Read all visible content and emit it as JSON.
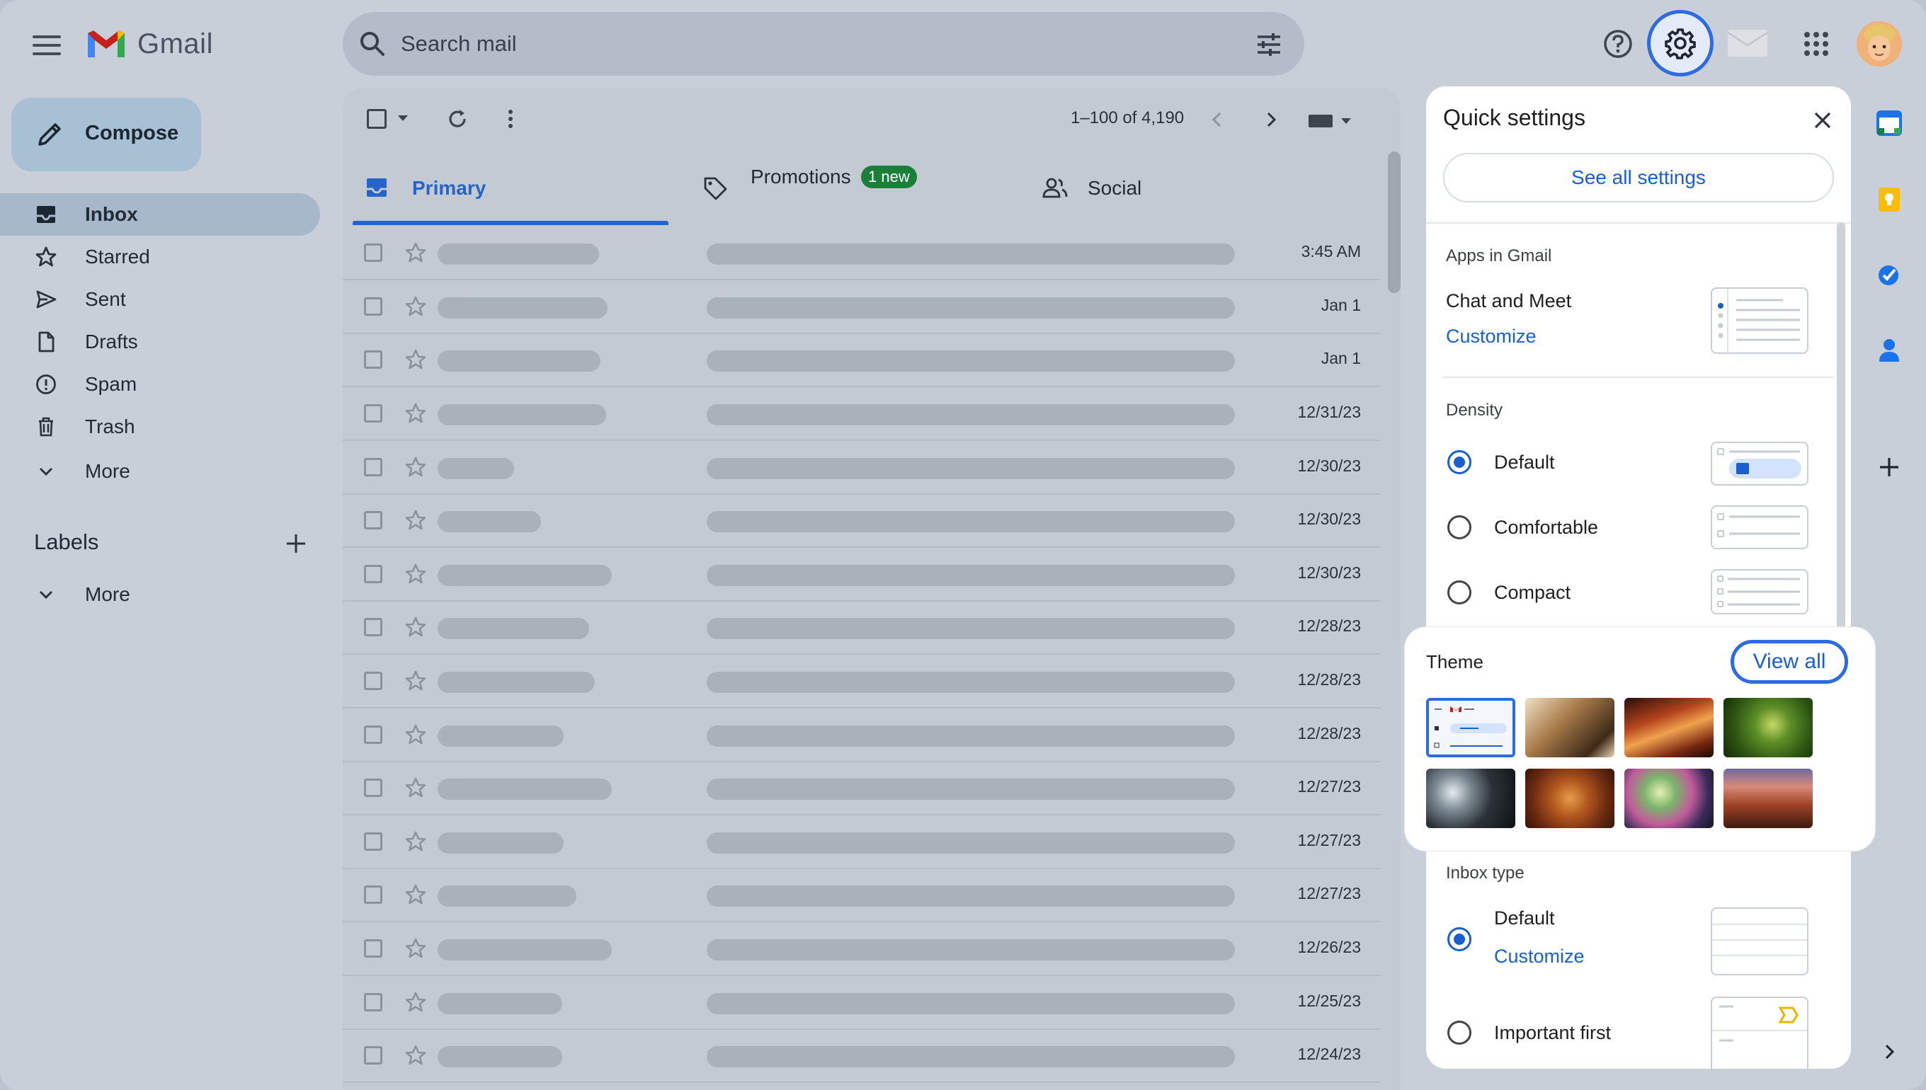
{
  "header": {
    "app_name": "Gmail",
    "search_placeholder": "Search mail"
  },
  "sidebar": {
    "compose_label": "Compose",
    "items": [
      {
        "label": "Inbox",
        "icon": "inbox-icon",
        "active": true
      },
      {
        "label": "Starred",
        "icon": "star-icon"
      },
      {
        "label": "Sent",
        "icon": "send-icon"
      },
      {
        "label": "Drafts",
        "icon": "draft-icon"
      },
      {
        "label": "Spam",
        "icon": "spam-icon"
      },
      {
        "label": "Trash",
        "icon": "trash-icon"
      },
      {
        "label": "More",
        "icon": "chevron-down-icon"
      }
    ],
    "labels_title": "Labels",
    "labels_more": "More"
  },
  "toolbar": {
    "pagination": "1–100 of 4,190"
  },
  "tabs": [
    {
      "label": "Primary",
      "icon": "inbox-tab-icon",
      "active": true
    },
    {
      "label": "Promotions",
      "icon": "tag-icon",
      "badge": "1 new"
    },
    {
      "label": "Social",
      "icon": "people-icon"
    }
  ],
  "emails": [
    {
      "date": "3:45 AM"
    },
    {
      "date": "Jan 1"
    },
    {
      "date": "Jan 1"
    },
    {
      "date": "12/31/23"
    },
    {
      "date": "12/30/23"
    },
    {
      "date": "12/30/23"
    },
    {
      "date": "12/30/23"
    },
    {
      "date": "12/28/23"
    },
    {
      "date": "12/28/23"
    },
    {
      "date": "12/28/23"
    },
    {
      "date": "12/27/23"
    },
    {
      "date": "12/27/23"
    },
    {
      "date": "12/27/23"
    },
    {
      "date": "12/26/23"
    },
    {
      "date": "12/25/23"
    },
    {
      "date": "12/24/23"
    }
  ],
  "quick_settings": {
    "title": "Quick settings",
    "see_all": "See all settings",
    "apps_section": "Apps in Gmail",
    "chat_meet": "Chat and Meet",
    "customize": "Customize",
    "density_section": "Density",
    "density_options": [
      "Default",
      "Comfortable",
      "Compact"
    ],
    "density_selected": "Default",
    "theme_title": "Theme",
    "view_all": "View all",
    "inbox_type_section": "Inbox type",
    "inbox_default": "Default",
    "inbox_customize": "Customize",
    "important_first": "Important first"
  },
  "colors": {
    "accent_blue": "#1a5fce",
    "badge_green": "#188038"
  }
}
